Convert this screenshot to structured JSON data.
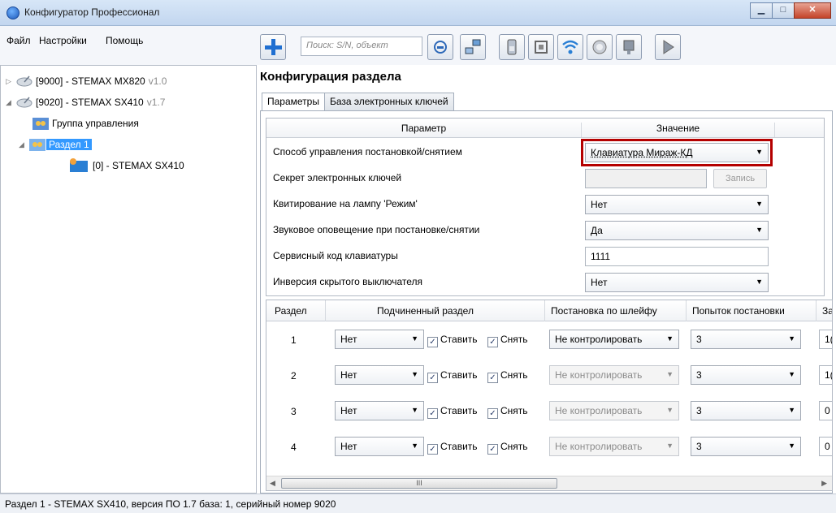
{
  "window": {
    "title": "Конфигуратор Профессионал",
    "minimize": "▁",
    "maximize": "□",
    "close": "✕"
  },
  "menu": {
    "file": "Файл",
    "settings": "Настройки",
    "help": "Помощь"
  },
  "toolbar": {
    "search_placeholder": "Поиск: S/N, объект"
  },
  "tree": {
    "items": [
      {
        "label": "[9000] - STEMAX MX820",
        "version": "v1.0"
      },
      {
        "label": "[9020] - STEMAX SX410",
        "version": "v1.7"
      },
      {
        "label": "Группа управления"
      },
      {
        "label": "Раздел 1"
      },
      {
        "label": "[0] - STEMAX SX410"
      }
    ]
  },
  "page": {
    "title": "Конфигурация раздела"
  },
  "tabs": [
    {
      "label": "Параметры"
    },
    {
      "label": "База электронных ключей"
    }
  ],
  "params": {
    "header": {
      "param": "Параметр",
      "value": "Значение"
    },
    "rows": [
      {
        "label": "Способ управления постановкой/снятием",
        "value": "Клавиатура Мираж-КД"
      },
      {
        "label": "Секрет электронных ключей",
        "value": "",
        "button": "Запись"
      },
      {
        "label": "Квитирование на лампу 'Режим'",
        "value": "Нет"
      },
      {
        "label": "Звуковое оповещение при постановке/снятии",
        "value": "Да"
      },
      {
        "label": "Сервисный код клавиатуры",
        "value": "1111"
      },
      {
        "label": "Инверсия скрытого выключателя",
        "value": "Нет"
      }
    ]
  },
  "grid": {
    "headers": {
      "section": "Раздел",
      "sub": "Подчиненный раздел",
      "loop": "Постановка по шлейфу",
      "attempts": "Попыток постановки",
      "next": "За"
    },
    "set_label": "Ставить",
    "unset_label": "Снять",
    "rows": [
      {
        "num": "1",
        "sub": "Нет",
        "loop": "Не контролировать",
        "attempts": "3",
        "next": "1("
      },
      {
        "num": "2",
        "sub": "Нет",
        "loop": "Не контролировать",
        "attempts": "3",
        "next": "1("
      },
      {
        "num": "3",
        "sub": "Нет",
        "loop": "Не контролировать",
        "attempts": "3",
        "next": "0"
      },
      {
        "num": "4",
        "sub": "Нет",
        "loop": "Не контролировать",
        "attempts": "3",
        "next": "0"
      }
    ],
    "scroll_grip": "III"
  },
  "status": {
    "text": "Раздел 1 - STEMAX SX410, версия ПО 1.7 база: 1, серийный номер 9020"
  }
}
